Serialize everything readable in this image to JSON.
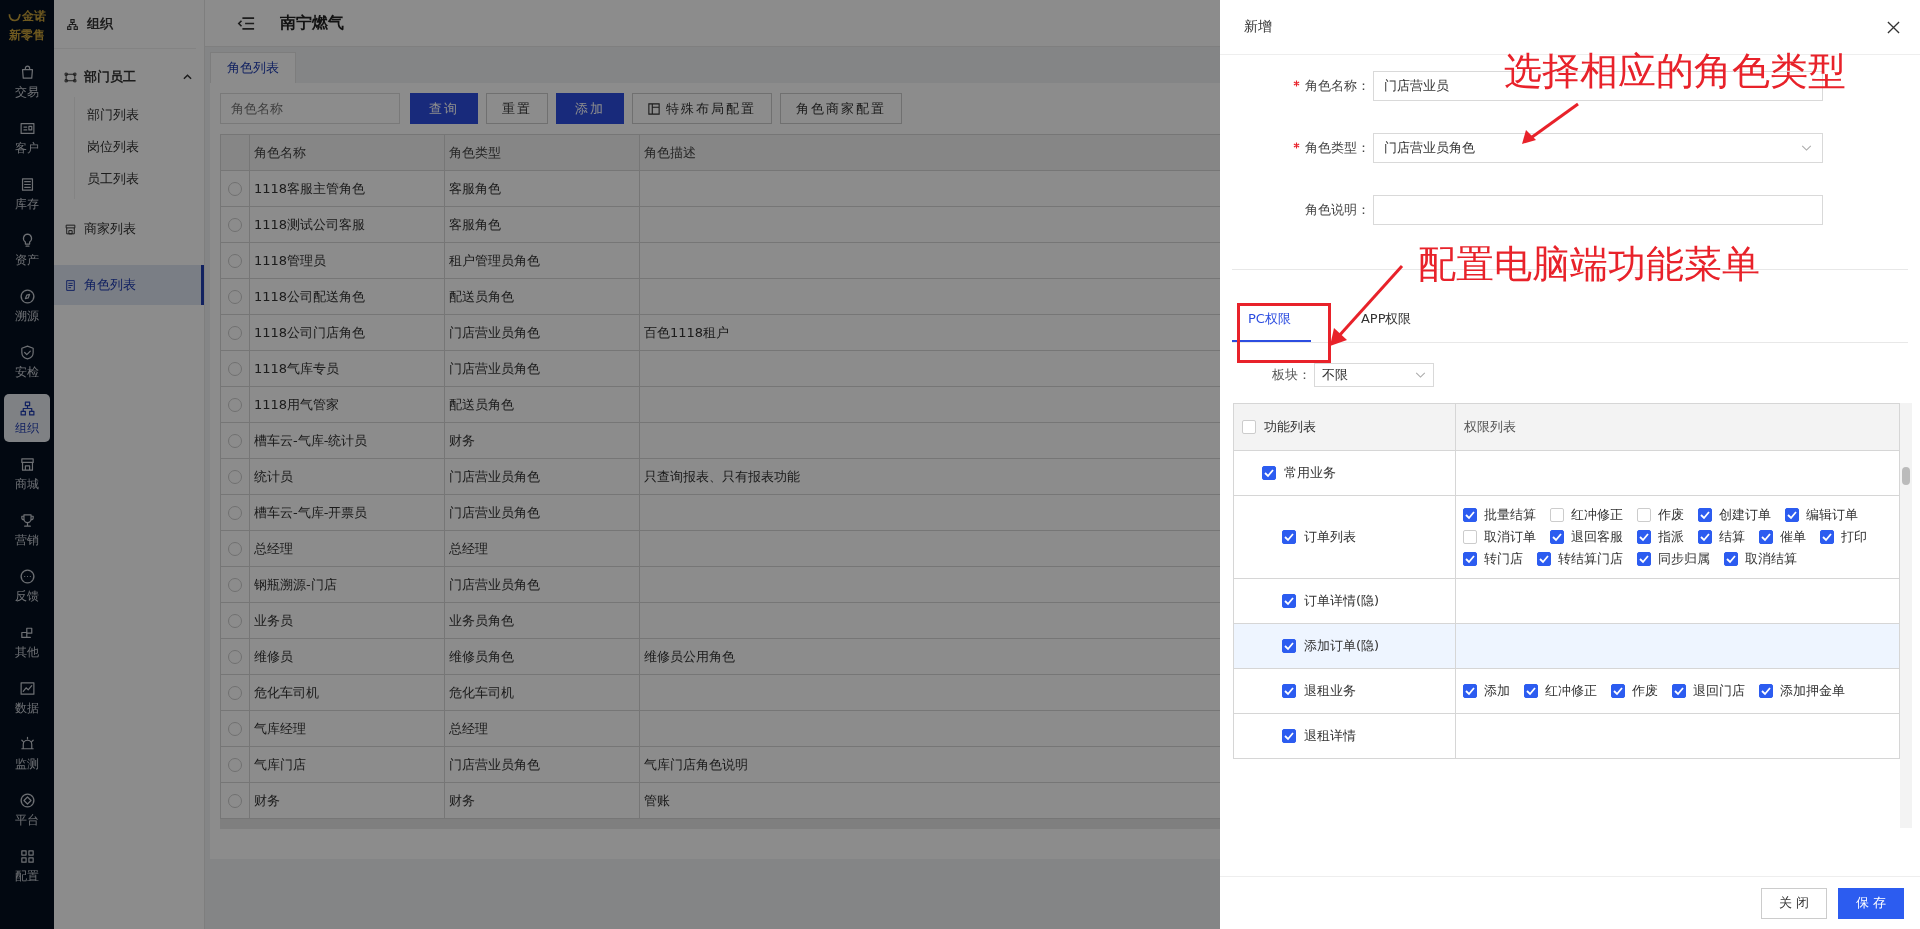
{
  "brand": {
    "name": "金诺",
    "subtitle": "新零售"
  },
  "nav": [
    {
      "label": "交易",
      "selected": false
    },
    {
      "label": "客户",
      "selected": false
    },
    {
      "label": "库存",
      "selected": false
    },
    {
      "label": "资产",
      "selected": false
    },
    {
      "label": "溯源",
      "selected": false
    },
    {
      "label": "安检",
      "selected": false
    },
    {
      "label": "组织",
      "selected": true
    },
    {
      "label": "商城",
      "selected": false
    },
    {
      "label": "营销",
      "selected": false
    },
    {
      "label": "反馈",
      "selected": false
    },
    {
      "label": "其他",
      "selected": false
    },
    {
      "label": "数据",
      "selected": false
    },
    {
      "label": "监测",
      "selected": false
    },
    {
      "label": "平台",
      "selected": false
    },
    {
      "label": "配置",
      "selected": false
    }
  ],
  "sidebar": {
    "title": "组织",
    "items": [
      {
        "label": "部门员工",
        "selected": false,
        "expanded": true,
        "children": [
          {
            "label": "部门列表",
            "selected": false
          },
          {
            "label": "岗位列表",
            "selected": false
          },
          {
            "label": "员工列表",
            "selected": false
          }
        ]
      },
      {
        "label": "商家列表",
        "selected": false
      },
      {
        "label": "角色列表",
        "selected": true
      }
    ]
  },
  "header": {
    "title": "南宁燃气"
  },
  "tabs": [
    {
      "label": "角色列表",
      "selected": true
    }
  ],
  "toolbar": {
    "search": {
      "placeholder": "角色名称"
    },
    "buttons": [
      {
        "label": "查询",
        "kind": "primary"
      },
      {
        "label": "重置",
        "kind": "default"
      },
      {
        "label": "添加",
        "kind": "primary"
      },
      {
        "label": "特殊布局配置",
        "kind": "icon"
      },
      {
        "label": "角色商家配置",
        "kind": "default"
      }
    ]
  },
  "table": {
    "columns": [
      "角色名称",
      "角色类型",
      "角色描述"
    ],
    "rows": [
      {
        "name": "1118客服主管角色",
        "type": "客服角色",
        "selected": false
      },
      {
        "name": "1118测试公司客服",
        "type": "客服角色",
        "selected": false
      },
      {
        "name": "1118管理员",
        "type": "租户管理员角色",
        "selected": false
      },
      {
        "name": "1118公司配送角色",
        "type": "配送员角色",
        "selected": false
      },
      {
        "name": "1118公司门店角色",
        "type": "门店营业员角色",
        "description": "百色1118租户",
        "selected": false
      },
      {
        "name": "1118气库专员",
        "type": "门店营业员角色",
        "selected": false
      },
      {
        "name": "1118用气管家",
        "type": "配送员角色",
        "selected": false
      },
      {
        "name": "槽车云-气库-统计员",
        "type": "财务",
        "selected": false
      },
      {
        "name": "统计员",
        "type": "门店营业员角色",
        "description": "只查询报表、只有报表功能",
        "selected": false
      },
      {
        "name": "槽车云-气库-开票员",
        "type": "门店营业员角色",
        "selected": false
      },
      {
        "name": "总经理",
        "type": "总经理",
        "selected": false
      },
      {
        "name": "钢瓶溯源-门店",
        "type": "门店营业员角色",
        "selected": false
      },
      {
        "name": "业务员",
        "type": "业务员角色",
        "selected": false
      },
      {
        "name": "维修员",
        "type": "维修员角色",
        "description": "维修员公用角色",
        "selected": false
      },
      {
        "name": "危化车司机",
        "type": "危化车司机",
        "selected": false
      },
      {
        "name": "气库经理",
        "type": "总经理",
        "selected": false
      },
      {
        "name": "气库门店",
        "type": "门店营业员角色",
        "description": "气库门店角色说明",
        "selected": false
      },
      {
        "name": "财务",
        "type": "财务",
        "description": "管账",
        "selected": false
      }
    ]
  },
  "drawer": {
    "title": "新增",
    "form": [
      {
        "label": "角色名称：",
        "required": true,
        "kind": "input",
        "value": "门店营业员"
      },
      {
        "label": "角色类型：",
        "required": true,
        "kind": "select",
        "value": "门店营业员角色"
      },
      {
        "label": "角色说明：",
        "required": false,
        "kind": "input"
      }
    ],
    "tabs": [
      {
        "label": "PC权限",
        "selected": true
      },
      {
        "label": "APP权限",
        "selected": false
      }
    ],
    "filter": {
      "label": "板块：",
      "value": "不限"
    },
    "permissions": {
      "columns": [
        "功能列表",
        "权限列表"
      ],
      "all_checked": false,
      "groups": [
        {
          "label": "常用业务",
          "checked": true,
          "children": [
            {
              "label": "订单列表",
              "checked": true,
              "highlighted": false,
              "rights": [
                {
                  "label": "批量结算",
                  "checked": true
                },
                {
                  "label": "红冲修正",
                  "checked": false
                },
                {
                  "label": "作废",
                  "checked": false
                },
                {
                  "label": "创建订单",
                  "checked": true
                },
                {
                  "label": "编辑订单",
                  "checked": true
                },
                {
                  "label": "取消订单",
                  "checked": false
                },
                {
                  "label": "退回客服",
                  "checked": true
                },
                {
                  "label": "指派",
                  "checked": true
                },
                {
                  "label": "结算",
                  "checked": true
                },
                {
                  "label": "催单",
                  "checked": true
                },
                {
                  "label": "打印",
                  "checked": true
                },
                {
                  "label": "转门店",
                  "checked": true
                },
                {
                  "label": "转结算门店",
                  "checked": true
                },
                {
                  "label": "同步归属",
                  "checked": true
                },
                {
                  "label": "取消结算",
                  "checked": true
                }
              ]
            },
            {
              "label": "订单详情(隐)",
              "checked": true,
              "highlighted": false
            },
            {
              "label": "添加订单(隐)",
              "checked": true,
              "highlighted": true
            },
            {
              "label": "退租业务",
              "checked": true,
              "highlighted": false,
              "rights": [
                {
                  "label": "添加",
                  "checked": true
                },
                {
                  "label": "红冲修正",
                  "checked": true
                },
                {
                  "label": "作废",
                  "checked": true
                },
                {
                  "label": "退回门店",
                  "checked": true
                },
                {
                  "label": "添加押金单",
                  "checked": true
                }
              ]
            },
            {
              "label": "退租详情",
              "checked": true,
              "highlighted": false
            }
          ]
        }
      ]
    },
    "buttons": [
      {
        "label": "关 闭",
        "kind": "default"
      },
      {
        "label": "保 存",
        "kind": "primary"
      }
    ]
  },
  "annotations": [
    {
      "text": "选择相应的角色类型"
    },
    {
      "text": "配置电脑端功能菜单"
    }
  ]
}
